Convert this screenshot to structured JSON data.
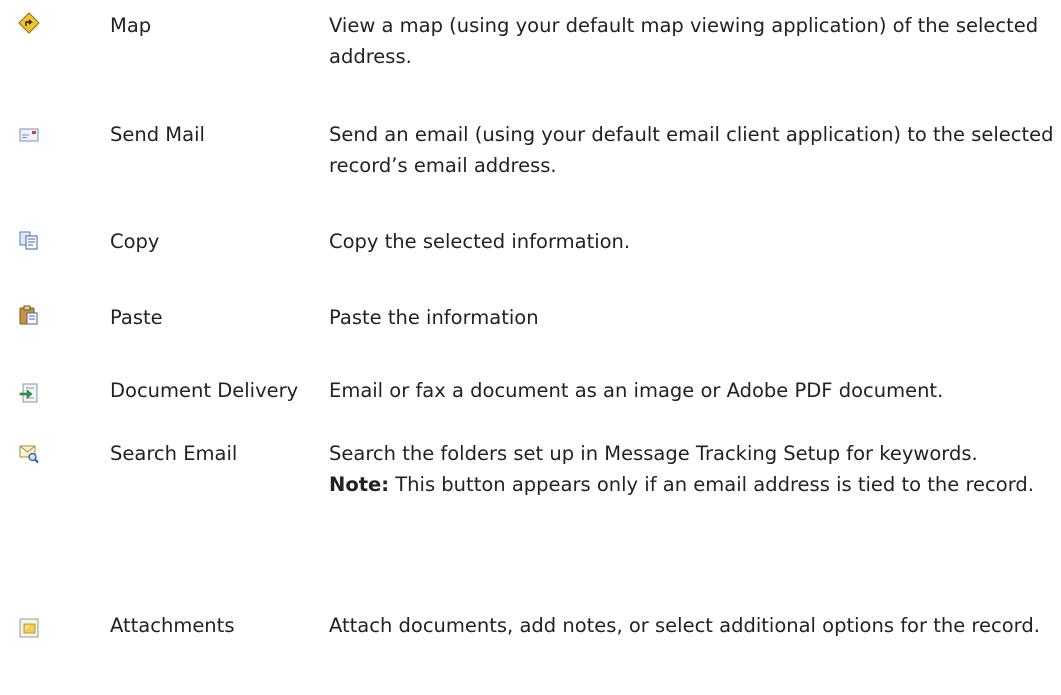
{
  "rows": [
    {
      "icon": "map-diamond-icon",
      "name": "Map",
      "desc": "View a map (using your default map viewing application) of the selected address."
    },
    {
      "icon": "envelope-icon",
      "name": "Send Mail",
      "desc": "Send an email (using your default email client application) to the selected record’s email address."
    },
    {
      "icon": "copy-icon",
      "name": "Copy",
      "desc": "Copy the selected information."
    },
    {
      "icon": "paste-clipboard-icon",
      "name": "Paste",
      "desc": "Paste the information"
    },
    {
      "icon": "document-delivery-icon",
      "name": "Document Delivery",
      "desc": "Email or fax a document as an image or Adobe PDF document."
    },
    {
      "icon": "search-email-icon",
      "name": "Search Email",
      "desc": "Search the folders set up in Message Tracking Setup for keywords.",
      "note_label": "Note:",
      "note_text": " This button appears only if an email address is tied to the record."
    },
    {
      "icon": "attachments-icon",
      "name": "Attachments",
      "desc": "Attach documents, add notes, or select additional options for the record."
    }
  ]
}
